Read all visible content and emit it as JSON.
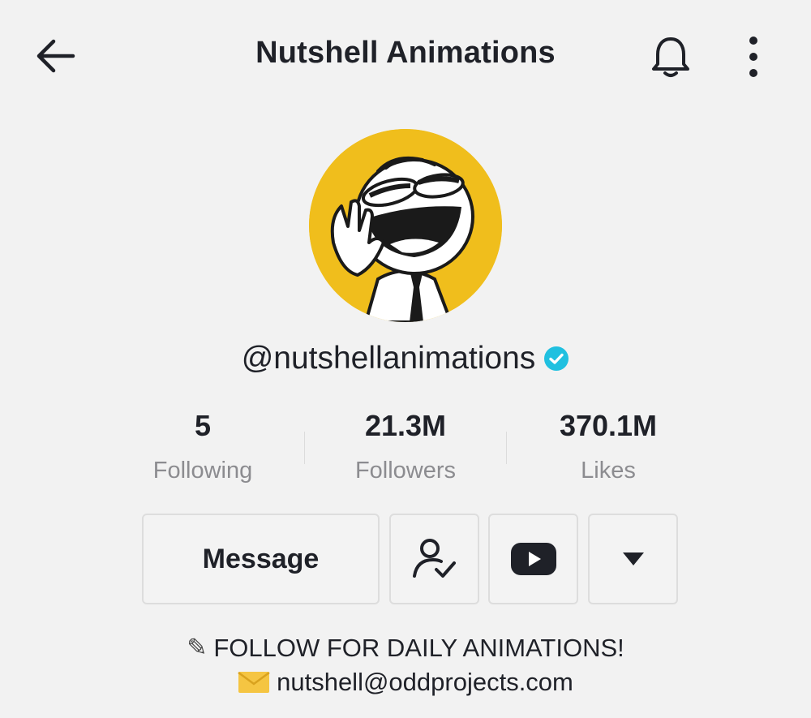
{
  "header": {
    "title": "Nutshell Animations",
    "back_icon": "arrow-left-icon",
    "bell_icon": "bell-icon",
    "more_icon": "more-vertical-icon"
  },
  "profile": {
    "handle": "@nutshellanimations",
    "verified": true,
    "avatar_bg": "#f0be1c"
  },
  "stats": [
    {
      "value": "5",
      "label": "Following"
    },
    {
      "value": "21.3M",
      "label": "Followers"
    },
    {
      "value": "370.1M",
      "label": "Likes"
    }
  ],
  "actions": {
    "message_label": "Message",
    "follow_icon": "user-check-icon",
    "youtube_icon": "youtube-icon",
    "dropdown_icon": "caret-down-icon"
  },
  "bio": {
    "line1": "FOLLOW FOR DAILY ANIMATIONS!",
    "line2": "nutshell@oddprojects.com",
    "line1_icon": "pencil-icon",
    "line2_icon": "envelope-icon"
  },
  "colors": {
    "background": "#f2f2f2",
    "text": "#1f2128",
    "muted": "#8c8c90",
    "verified": "#20c0e0",
    "accent_yellow": "#f0be1c"
  }
}
